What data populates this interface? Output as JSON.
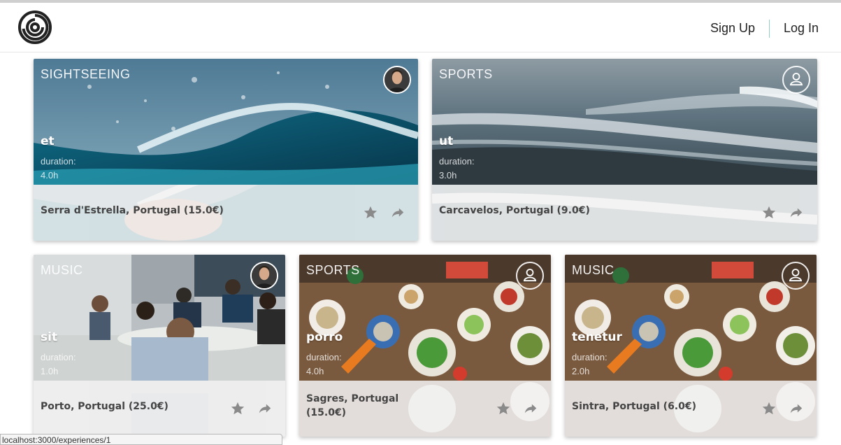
{
  "nav": {
    "signup": "Sign Up",
    "login": "Log In"
  },
  "cards": [
    {
      "category": "SIGHTSEEING",
      "title": "et",
      "duration_label": "duration:",
      "duration": "4.0h",
      "location": "Serra d'Estrella, Portugal (15.0€)",
      "image": "wave",
      "avatar": "photo"
    },
    {
      "category": "SPORTS",
      "title": "ut",
      "duration_label": "duration:",
      "duration": "3.0h",
      "location": "Carcavelos, Portugal (9.0€)",
      "image": "sea",
      "avatar": "placeholder"
    },
    {
      "category": "MUSIC",
      "title": "sit",
      "duration_label": "duration:",
      "duration": "1.0h",
      "location": "Porto, Portugal (25.0€)",
      "image": "workshop",
      "avatar": "photo"
    },
    {
      "category": "SPORTS",
      "title": "porro",
      "duration_label": "duration:",
      "duration": "4.0h",
      "location_line1": "Sagres, Portugal",
      "location_line2": "(15.0€)",
      "image": "food",
      "avatar": "placeholder"
    },
    {
      "category": "MUSIC",
      "title": "tenetur",
      "duration_label": "duration:",
      "duration": "2.0h",
      "location": "Sintra, Portugal (6.0€)",
      "image": "food",
      "avatar": "placeholder"
    }
  ],
  "status_url": "localhost:3000/experiences/1",
  "icons": {
    "logo": "spiral-logo-icon",
    "star": "star-icon",
    "share": "share-arrow-icon",
    "user": "user-icon"
  },
  "colors": {
    "accent_separator": "#8fcfc7",
    "icon_gray": "#8a8a8a"
  }
}
